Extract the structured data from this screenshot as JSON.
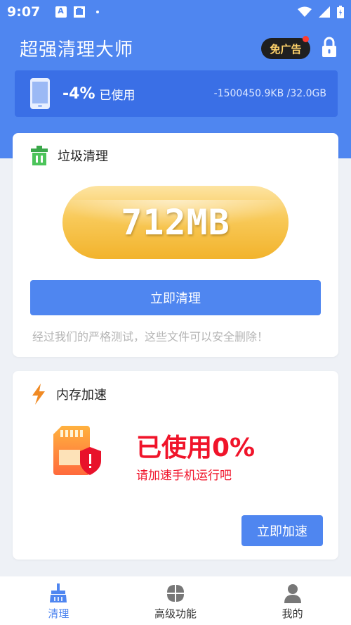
{
  "status_bar": {
    "time": "9:07",
    "icons_left": [
      "a-notification-icon",
      "download-notification-icon",
      "dot"
    ],
    "icons_right": [
      "wifi-icon",
      "signal-icon",
      "battery-icon"
    ]
  },
  "header": {
    "title": "超强清理大师",
    "ad_free_label": "免广告",
    "lock_icon": "lock-icon"
  },
  "storage": {
    "percent": "-4%",
    "used_label": "已使用",
    "capacity": "-1500450.9KB /32.0GB"
  },
  "junk_card": {
    "title": "垃圾清理",
    "size": "712MB",
    "button_label": "立即清理",
    "tip": "经过我们的严格测试，这些文件可以安全删除！"
  },
  "memory_card": {
    "title": "内存加速",
    "usage": "已使用0%",
    "hint": "请加速手机运行吧",
    "button_label": "立即加速"
  },
  "bottom_nav": [
    {
      "label": "清理",
      "icon": "broom-icon",
      "active": true
    },
    {
      "label": "高级功能",
      "icon": "grid-icon",
      "active": false
    },
    {
      "label": "我的",
      "icon": "user-icon",
      "active": false
    }
  ],
  "colors": {
    "primary": "#4f86f0",
    "storage_bar": "#3a6fe6",
    "alert_red": "#f0142a",
    "junk_gold": "#f5bd3c"
  }
}
